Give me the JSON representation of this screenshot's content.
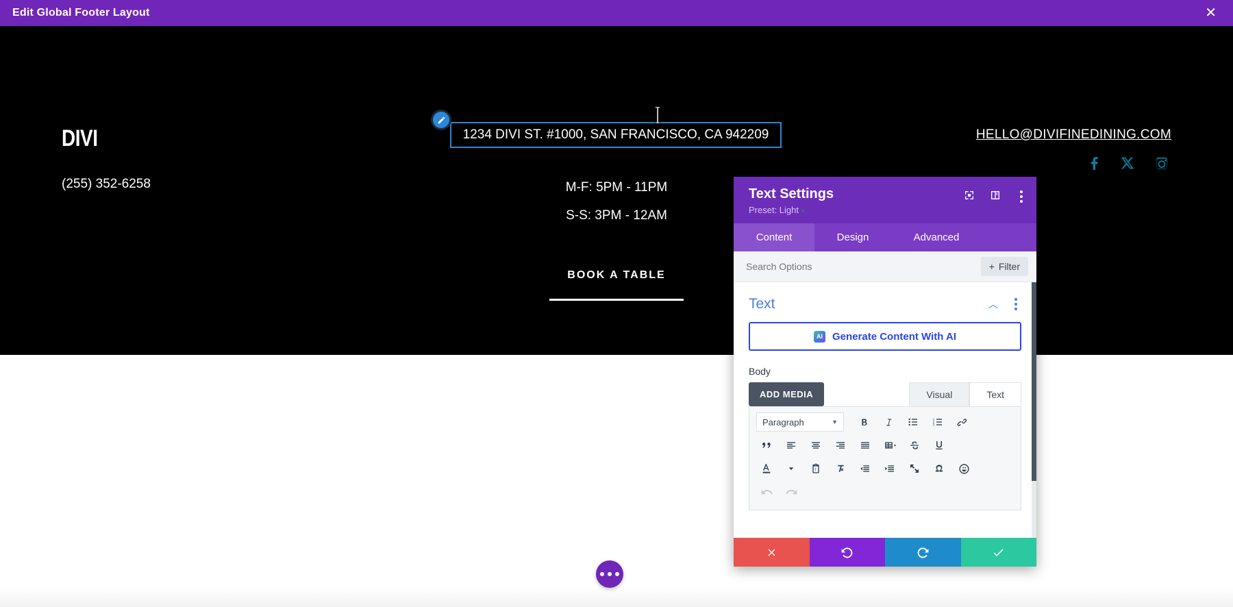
{
  "topbar": {
    "title": "Edit Global Footer Layout",
    "close_label": "✕"
  },
  "footer": {
    "logo": "DIVI",
    "phone": "(255) 352-6258",
    "address": "1234 DIVI ST. #1000, SAN FRANCISCO, CA 942209",
    "hours_weekday": "M-F: 5PM - 11PM",
    "hours_weekend": "S-S: 3PM - 12AM",
    "cta": "BOOK A TABLE",
    "email": "HELLO@DIVIFINEDINING.COM",
    "socials": [
      "facebook-icon",
      "x-icon",
      "instagram-icon"
    ],
    "social_color": "#0d7f9e",
    "selection_color": "#2b87da"
  },
  "modal": {
    "title": "Text Settings",
    "preset": "Preset: Light",
    "header_icons": [
      "expand-icon",
      "panel-layout-icon",
      "more-options-icon"
    ],
    "tabs": [
      {
        "label": "Content",
        "active": true
      },
      {
        "label": "Design",
        "active": false
      },
      {
        "label": "Advanced",
        "active": false
      }
    ],
    "search_placeholder": "Search Options",
    "search_value": "",
    "filter_label": "Filter",
    "section": {
      "title": "Text",
      "collapse_icon": "chevron-up-icon",
      "menu_icon": "more-options-icon"
    },
    "ai_button": {
      "label": "Generate Content With AI",
      "badge": "AI",
      "color": "#2b44ea"
    },
    "body_label": "Body",
    "add_media_label": "ADD MEDIA",
    "editor_tabs": [
      {
        "label": "Visual",
        "active": false
      },
      {
        "label": "Text",
        "active": true
      }
    ],
    "format_select": "Paragraph",
    "toolbar_row1": [
      "bold-icon",
      "italic-icon",
      "bullet-list-icon",
      "numbered-list-icon",
      "link-icon"
    ],
    "toolbar_row2": [
      "blockquote-icon",
      "align-left-icon",
      "align-center-icon",
      "align-right-icon",
      "align-justify-icon",
      "table-icon",
      "strikethrough-icon",
      "underline-icon"
    ],
    "toolbar_row3": [
      "text-color-icon",
      "paste-as-text-icon",
      "clear-formatting-icon",
      "outdent-icon",
      "indent-icon",
      "fullscreen-icon",
      "special-character-icon",
      "emoji-icon"
    ],
    "toolbar_row4": [
      "undo-icon",
      "redo-icon"
    ],
    "footer_buttons": [
      {
        "name": "discard",
        "icon": "close-icon",
        "color": "#e8524f"
      },
      {
        "name": "undo",
        "icon": "undo-icon",
        "color": "#8127d8"
      },
      {
        "name": "redo",
        "icon": "redo-icon",
        "color": "#1e8ccb"
      },
      {
        "name": "save",
        "icon": "check-icon",
        "color": "#2cc8a0"
      }
    ]
  },
  "page_settings_fab": {
    "icon": "ellipsis-icon",
    "color": "#7026b9"
  }
}
